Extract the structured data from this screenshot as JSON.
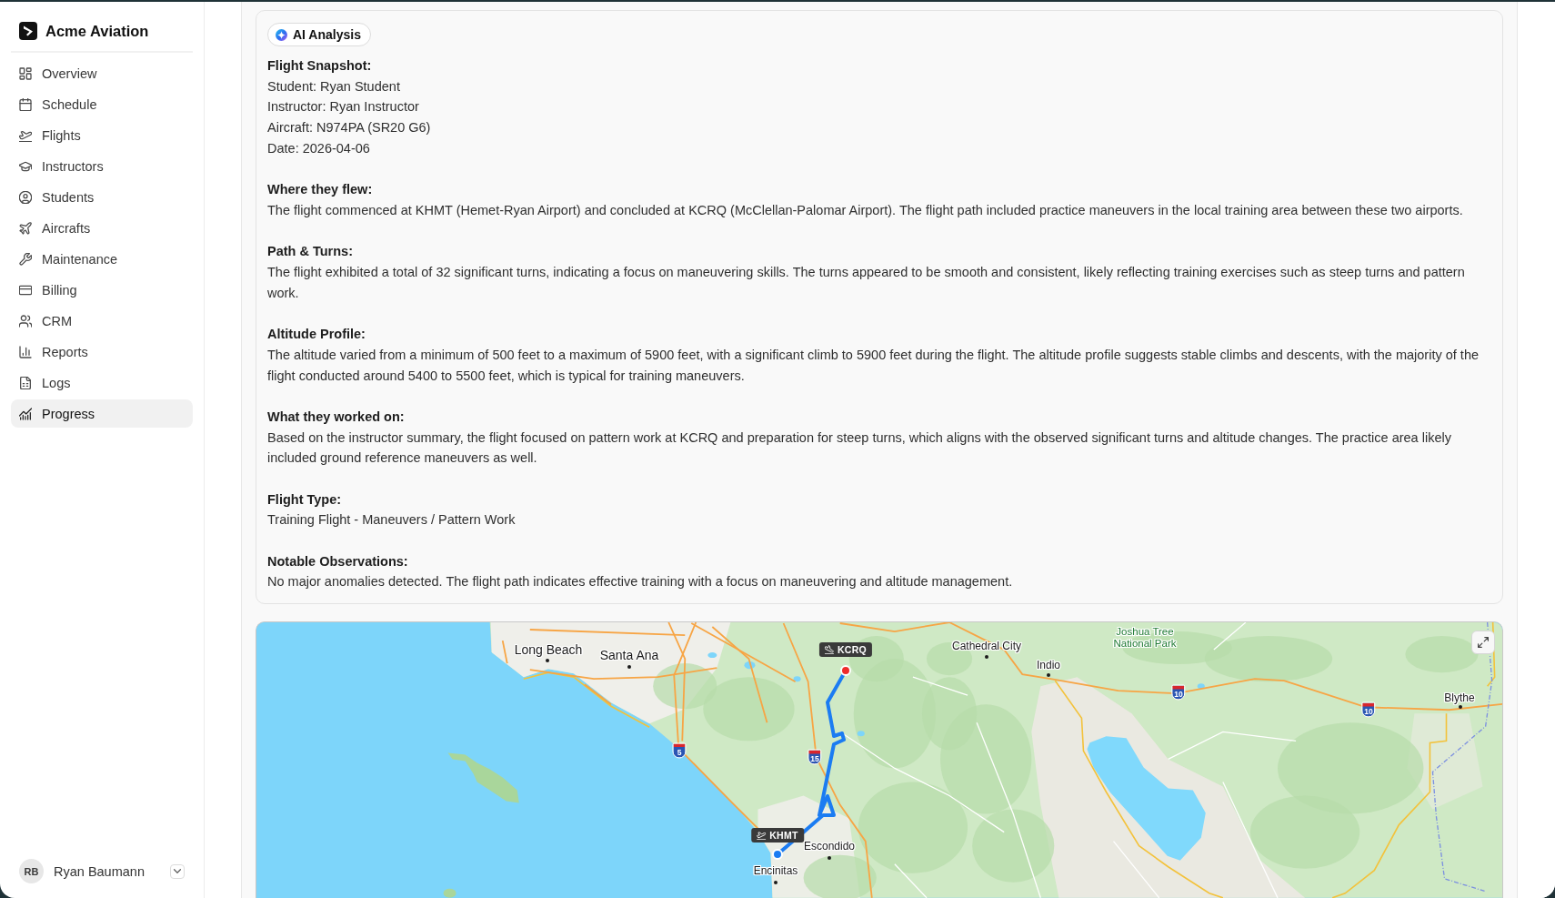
{
  "sidebar": {
    "brand": "Acme Aviation",
    "items": [
      {
        "label": "Overview",
        "selected": false
      },
      {
        "label": "Schedule",
        "selected": false
      },
      {
        "label": "Flights",
        "selected": false
      },
      {
        "label": "Instructors",
        "selected": false
      },
      {
        "label": "Students",
        "selected": false
      },
      {
        "label": "Aircrafts",
        "selected": false
      },
      {
        "label": "Maintenance",
        "selected": false
      },
      {
        "label": "Billing",
        "selected": false
      },
      {
        "label": "CRM",
        "selected": false
      },
      {
        "label": "Reports",
        "selected": false
      },
      {
        "label": "Logs",
        "selected": false
      },
      {
        "label": "Progress",
        "selected": true
      }
    ],
    "user": {
      "initials": "RB",
      "name": "Ryan Baumann"
    }
  },
  "analysis": {
    "badge": "AI Analysis",
    "sections": [
      {
        "heading": "Flight Snapshot:",
        "lines": [
          "Student: Ryan Student",
          "Instructor: Ryan Instructor",
          "Aircraft: N974PA (SR20 G6)",
          "Date: 2026-04-06"
        ]
      },
      {
        "heading": "Where they flew:",
        "lines": [
          "The flight commenced at KHMT (Hemet-Ryan Airport) and concluded at KCRQ (McClellan-Palomar Airport). The flight path included practice maneuvers in the local training area between these two airports."
        ]
      },
      {
        "heading": "Path & Turns:",
        "lines": [
          "The flight exhibited a total of 32 significant turns, indicating a focus on maneuvering skills. The turns appeared to be smooth and consistent, likely reflecting training exercises such as steep turns and pattern work."
        ]
      },
      {
        "heading": "Altitude Profile:",
        "lines": [
          "The altitude varied from a minimum of 500 feet to a maximum of 5900 feet, with a significant climb to 5900 feet during the flight. The altitude profile suggests stable climbs and descents, with the majority of the flight conducted around 5400 to 5500 feet, which is typical for training maneuvers."
        ]
      },
      {
        "heading": "What they worked on:",
        "lines": [
          "Based on the instructor summary, the flight focused on pattern work at KCRQ and preparation for steep turns, which aligns with the observed significant turns and altitude changes. The practice area likely included ground reference maneuvers as well."
        ]
      },
      {
        "heading": "Flight Type:",
        "lines": [
          "Training Flight - Maneuvers / Pattern Work"
        ]
      },
      {
        "heading": "Notable Observations:",
        "lines": [
          "No major anomalies detected. The flight path indicates effective training with a focus on maneuvering and altitude management."
        ]
      }
    ]
  },
  "map": {
    "places": [
      {
        "name": "Long Beach",
        "kind": "major"
      },
      {
        "name": "Santa Ana",
        "kind": "major"
      },
      {
        "name": "Cathedral City",
        "kind": "city"
      },
      {
        "name": "Joshua Tree National Park",
        "kind": "park"
      },
      {
        "name": "Indio",
        "kind": "city"
      },
      {
        "name": "Blythe",
        "kind": "city"
      },
      {
        "name": "Escondido",
        "kind": "city"
      },
      {
        "name": "Encinitas",
        "kind": "city"
      }
    ],
    "highways": [
      "10",
      "10",
      "5",
      "15"
    ],
    "airports": [
      {
        "code": "KCRQ",
        "kind": "arrival"
      },
      {
        "code": "KHMT",
        "kind": "departure"
      }
    ]
  }
}
